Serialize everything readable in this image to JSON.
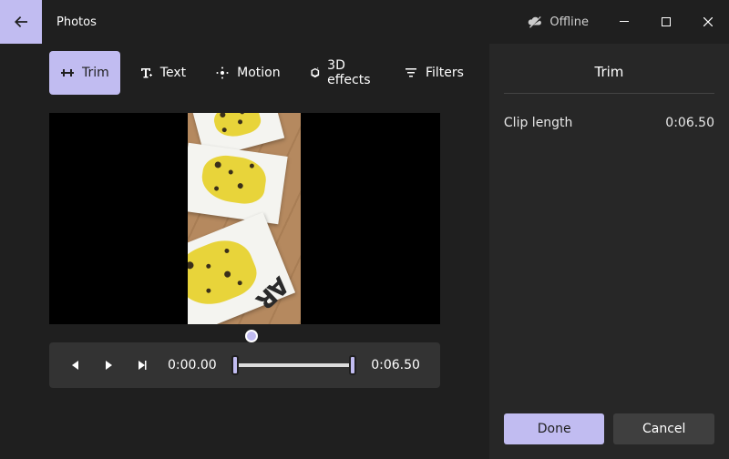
{
  "app": {
    "title": "Photos"
  },
  "offline": {
    "label": "Offline"
  },
  "toolbar": {
    "trim": "Trim",
    "text": "Text",
    "motion": "Motion",
    "effects": "3D effects",
    "filters": "Filters"
  },
  "playback": {
    "current_time": "0:00.00",
    "end_time": "0:06.50"
  },
  "panel": {
    "title": "Trim",
    "clip_length_label": "Clip length",
    "clip_length_value": "0:06.50",
    "done": "Done",
    "cancel": "Cancel"
  }
}
